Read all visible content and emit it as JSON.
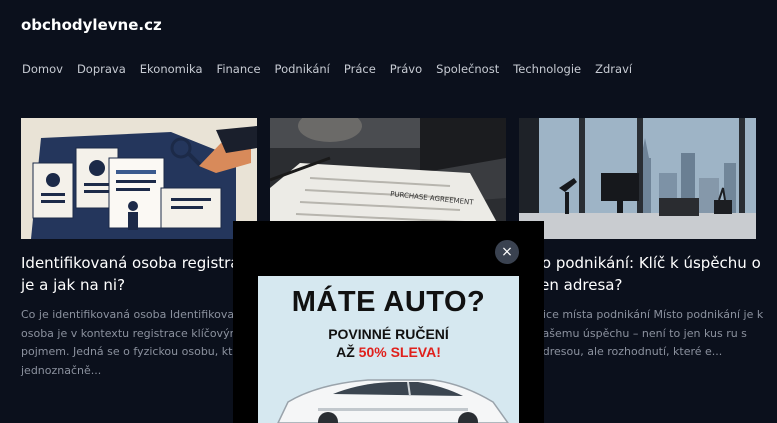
{
  "site": {
    "title": "obchodylevne.cz"
  },
  "nav": [
    "Domov",
    "Doprava",
    "Ekonomika",
    "Finance",
    "Podnikání",
    "Práce",
    "Právo",
    "Společnost",
    "Technologie",
    "Zdraví"
  ],
  "cards": [
    {
      "title": "Identifikovaná osoba registrace to je a jak na ni?",
      "excerpt": "Co je identifikovaná osoba Identifikovaná osoba je v kontextu registrace klíčovým pojmem. Jedná se o fyzickou osobu, které jednoznačně..."
    },
    {
      "title": "to podnikání: Klíč k úspěchu o jen adresa?",
      "excerpt": "nice místa podnikání Místo podnikání je k vašemu úspěchu – není to jen kus ru s adresou, ale rozhodnutí, které e..."
    }
  ],
  "thumb2_label": "PURCHASE AGREEMENT",
  "popup": {
    "close": "×",
    "headline": "MÁTE AUTO?",
    "line1": "POVINNÉ RUČENÍ",
    "line2_prefix": "AŽ ",
    "line2_highlight": "50% SLEVA!"
  }
}
